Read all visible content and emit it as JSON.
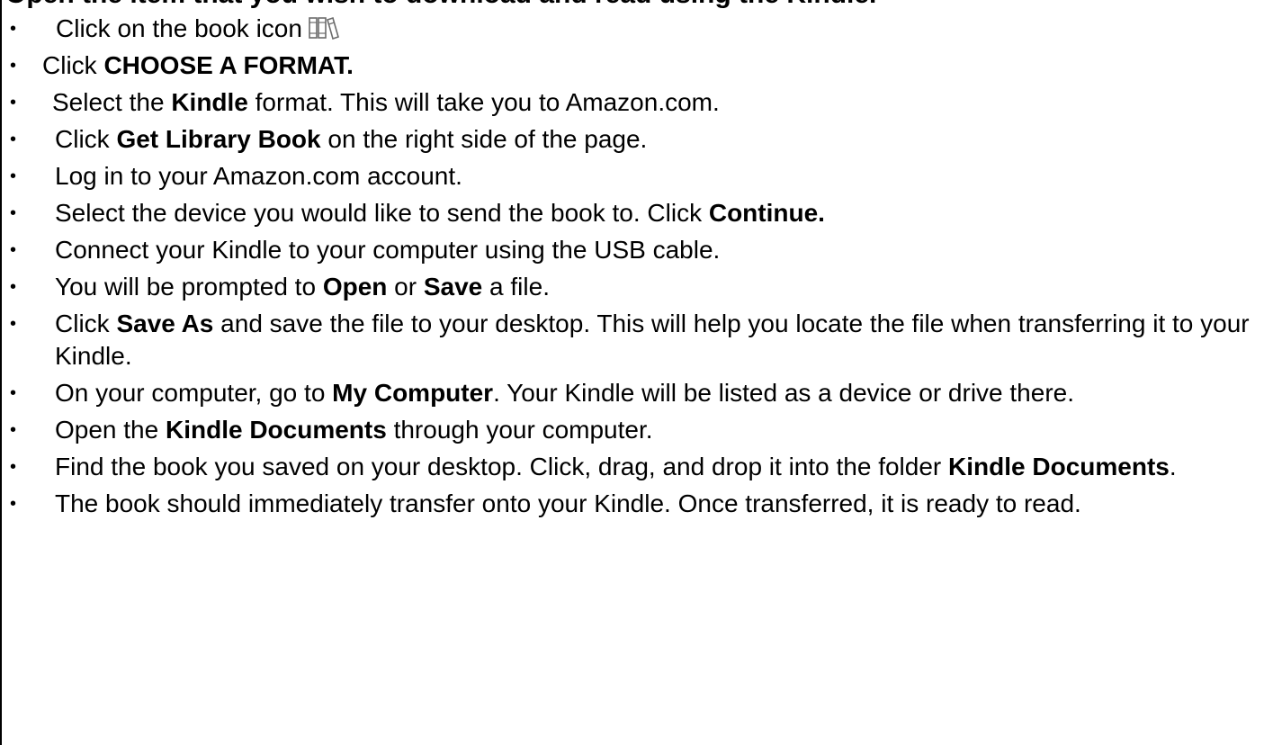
{
  "cut_heading": "Open the item that you wish to download and read using the Kindle.",
  "steps": [
    {
      "parts": [
        "Click on the book icon"
      ],
      "icon": "book-icon"
    },
    {
      "parts": [
        "Click ",
        "CHOOSE A FORMAT."
      ]
    },
    {
      "parts": [
        "Select the ",
        "Kindle",
        " format. This will take you to Amazon.com."
      ]
    },
    {
      "parts": [
        "Click ",
        "Get Library Book",
        " on the right side of the page."
      ]
    },
    {
      "parts": [
        "Log in to your Amazon.com account."
      ]
    },
    {
      "parts": [
        "Select the device you would like to send the book to. Click ",
        "Continue."
      ]
    },
    {
      "parts": [
        "Connect your Kindle to your computer using the USB cable."
      ]
    },
    {
      "parts": [
        "You will be prompted to ",
        "Open",
        " or ",
        "Save",
        " a file."
      ]
    },
    {
      "parts": [
        "Click ",
        "Save As",
        " and save the file to your desktop. This will help you locate the file when transferring it to your Kindle."
      ]
    },
    {
      "parts": [
        "On your computer, go to ",
        "My Computer",
        ". Your Kindle will be listed as a device or drive there."
      ]
    },
    {
      "parts": [
        "Open the ",
        "Kindle Documents",
        " through your computer."
      ]
    },
    {
      "parts": [
        "Find the book you saved on your desktop. Click, drag, and drop it into the folder ",
        "Kindle Documents",
        "."
      ]
    },
    {
      "parts": [
        "The book should immediately transfer onto your Kindle. Once transferred, it is ready to read."
      ]
    }
  ],
  "bullet_glyph": "•",
  "colors": {
    "text": "#000000",
    "background": "#ffffff",
    "icon_stroke": "#6b6b6b"
  }
}
